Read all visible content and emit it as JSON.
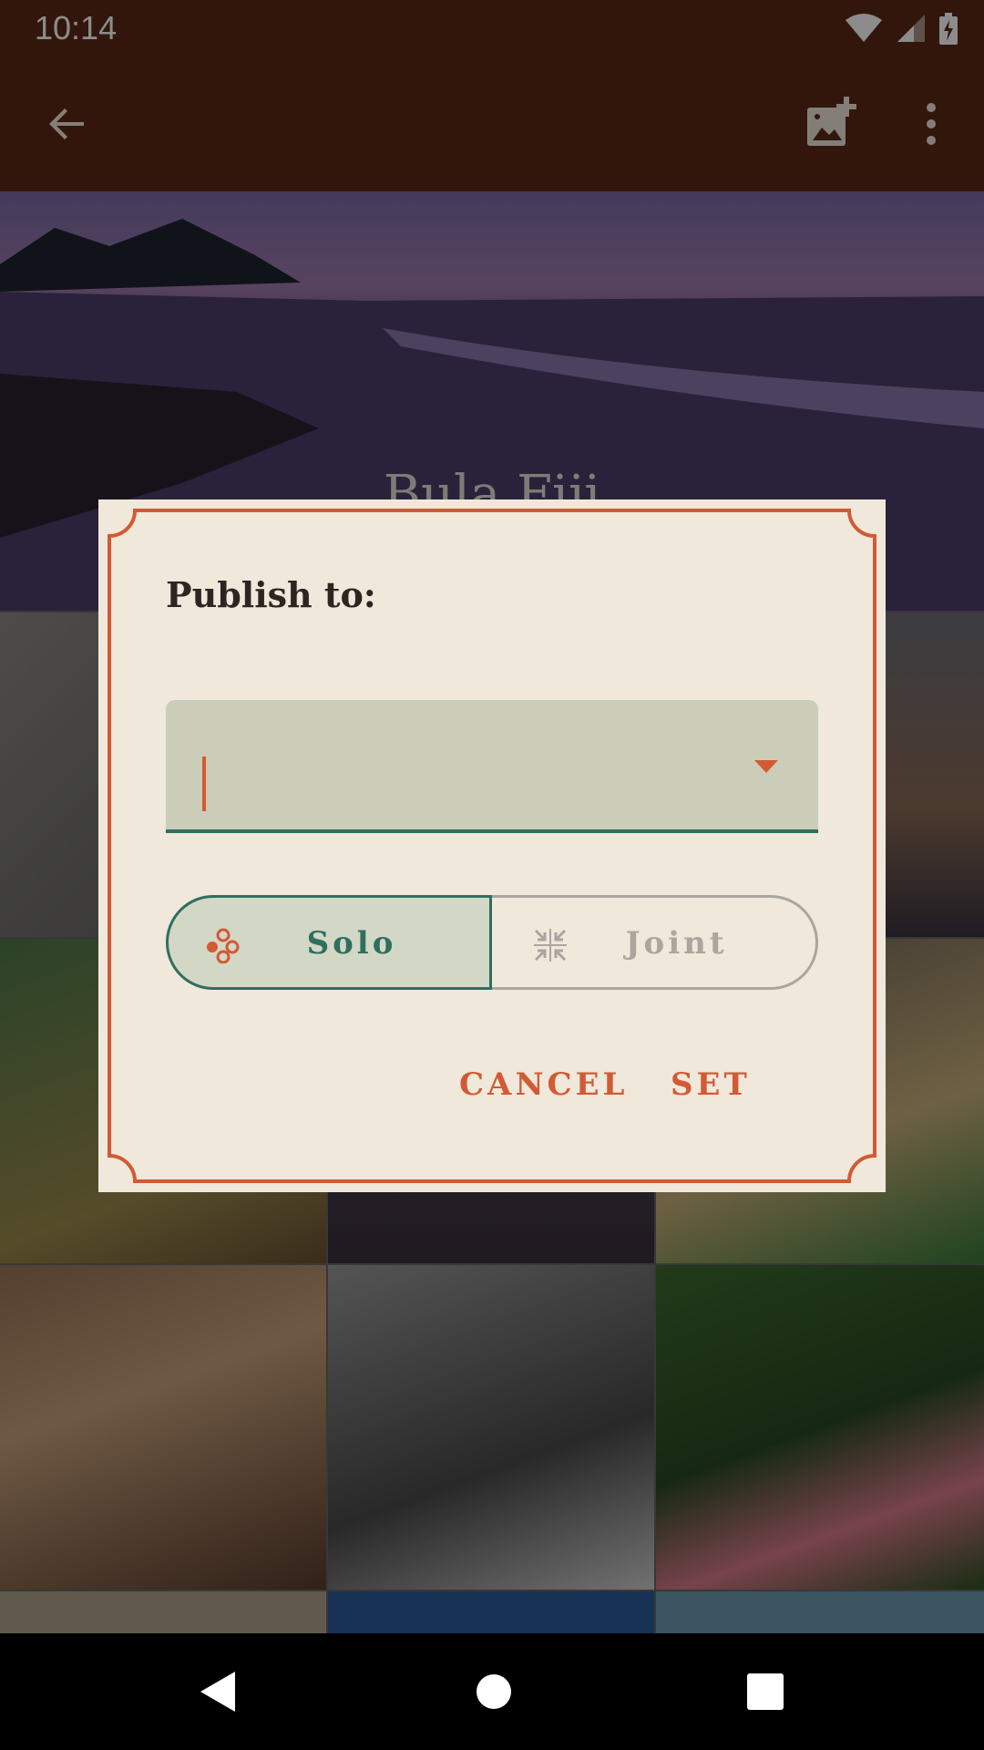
{
  "status_bar": {
    "time": "10:14",
    "icons": [
      "wifi-icon",
      "cell-signal-icon",
      "battery-charging-icon"
    ]
  },
  "app_bar": {
    "back_icon": "arrow-back-icon",
    "actions": [
      "add-photo-icon",
      "more-vert-icon"
    ]
  },
  "gallery": {
    "featured_title": "Bula Fiji"
  },
  "dialog": {
    "title": "Publish to:",
    "dropdown": {
      "value": "",
      "placeholder": ""
    },
    "toggle": {
      "options": [
        {
          "label": "Solo",
          "icon": "group-dots-icon",
          "selected": true
        },
        {
          "label": "Joint",
          "icon": "merge-arrows-icon",
          "selected": false
        }
      ]
    },
    "actions": {
      "cancel": "CANCEL",
      "set": "SET"
    }
  },
  "colors": {
    "app_bar": "#5c2816",
    "dialog_bg": "#efe8db",
    "accent": "#d25a34",
    "primary": "#2e6f5f",
    "field_bg": "#cbcdb8"
  }
}
